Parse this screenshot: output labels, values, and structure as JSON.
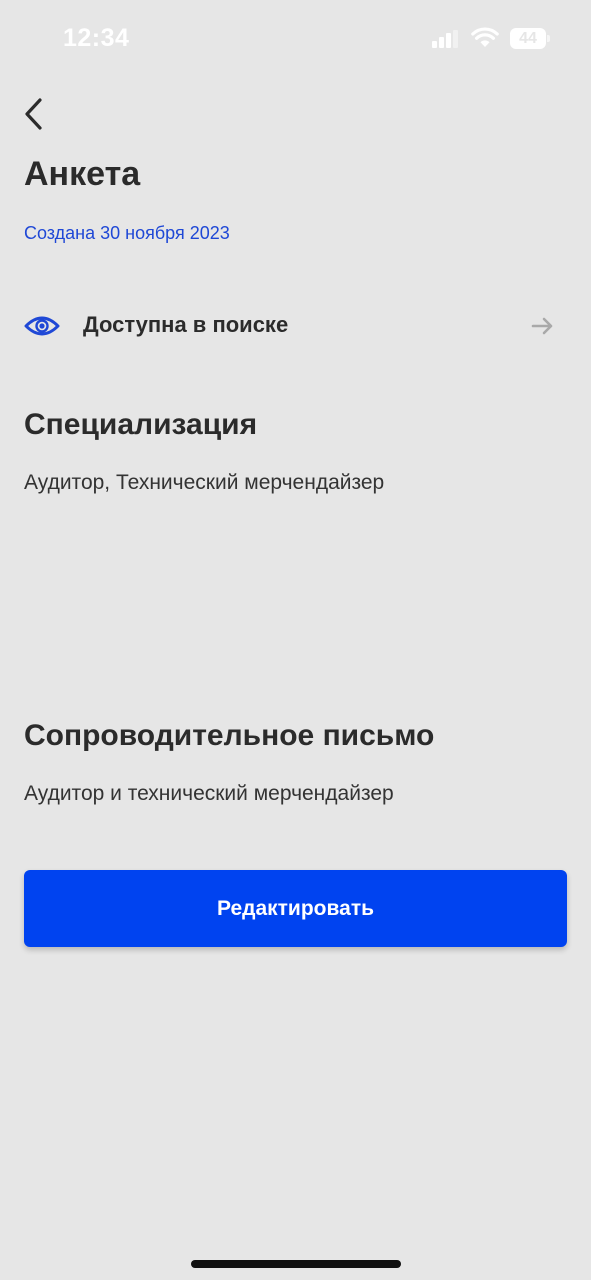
{
  "status_bar": {
    "time": "12:34",
    "battery": "44"
  },
  "page": {
    "title": "Анкета",
    "created": "Создана 30 ноября 2023"
  },
  "visibility": {
    "label": "Доступна в поиске"
  },
  "specialization": {
    "title": "Специализация",
    "text": "Аудитор, Технический мерчендайзер"
  },
  "cover_letter": {
    "title": "Сопроводительное письмо",
    "text": "Аудитор и технический мерчендайзер"
  },
  "actions": {
    "edit_label": "Редактировать"
  },
  "colors": {
    "background": "#e6e6e6",
    "accent": "#0043f0",
    "link": "#1f48d6",
    "text": "#2b2b2b"
  }
}
